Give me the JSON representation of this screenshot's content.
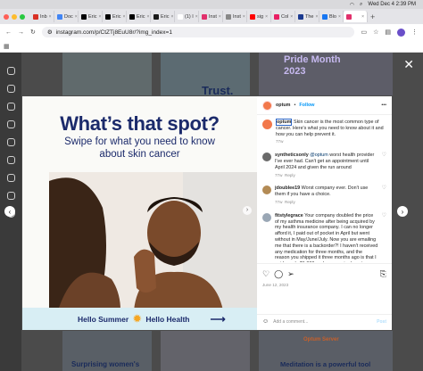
{
  "macbar": {
    "datetime": "Wed Dec 4  2:39 PM"
  },
  "tabs": [
    {
      "label": "Inb",
      "color": "#d93025"
    },
    {
      "label": "Doc",
      "color": "#4285f4"
    },
    {
      "label": "Eric",
      "color": "#000000"
    },
    {
      "label": "Eric",
      "color": "#000000"
    },
    {
      "label": "Eric",
      "color": "#000000"
    },
    {
      "label": "Eric",
      "color": "#1a1a1a"
    },
    {
      "label": "(1) I",
      "color": "#ffffff"
    },
    {
      "label": "Inst",
      "color": "#e1306c"
    },
    {
      "label": "Inst",
      "color": "#888888"
    },
    {
      "label": "sig",
      "color": "#ff0000"
    },
    {
      "label": "Col",
      "color": "#e91e63"
    },
    {
      "label": "The",
      "color": "#1b3a8f"
    },
    {
      "label": "Blo",
      "color": "#1877f2"
    },
    {
      "label": "",
      "color": "#e1306c"
    }
  ],
  "browser": {
    "url": "instagram.com/p/CtZTj8EuU8r/?img_index=1"
  },
  "background": {
    "pride_heading": "Pride Month 2023",
    "trust": "Trust.",
    "surprising": "Surprising women's",
    "meditation": "Meditation is a powerful tool",
    "optum_server": "Optum Server"
  },
  "post": {
    "headline": "What’s that spot?",
    "subhead_1": "Swipe for what you need to know",
    "subhead_2": "about skin cancer",
    "banner_left": "Hello Summer",
    "banner_right": "Hello Health",
    "banner_arrow": "⟶"
  },
  "sidebar": {
    "account": "optum",
    "follow": "Follow",
    "more": "•••",
    "caption_user": "optum",
    "caption": "Skin cancer is the most common type of cancer. Here's what you need to know about it and how you can help prevent it.",
    "caption_time": "77w",
    "comments": [
      {
        "user": "syntheticsonly",
        "mention": "@optum",
        "text": "worst health provider I've ever had. Can't get an appointment until April 2024 and given the run around",
        "time": "77w",
        "reply": "Reply"
      },
      {
        "user": "jdoublee19",
        "text": "Worst company ever. Don't use them if you have a choice.",
        "time": "77w",
        "reply": "Reply"
      },
      {
        "user": "fitstylegrace",
        "text": "Your company doubled the price of my asthma medicine after being acquired by my health insurance company. I can no longer afford it, I paid out of pocket in April but went without in May/June/July. Now you are emailing me that there is a backorder?! I haven't received any medication for three months, and the reason you shipped it three months ago is that I paid nearly $1,000 and you required me to pay in full before",
        "time": "",
        "reply": ""
      }
    ],
    "date": "June 12, 2023",
    "add_comment": "Add a comment...",
    "post_btn": "Post"
  }
}
